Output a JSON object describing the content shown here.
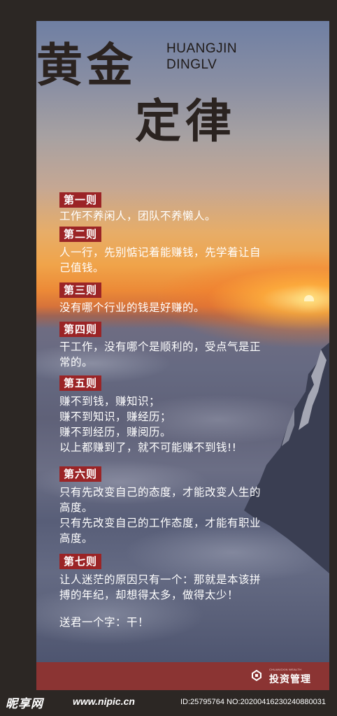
{
  "title": {
    "line1": "黄金",
    "line2": "定律",
    "english_line1": "HUANGJIN",
    "english_line2": "DINGLV"
  },
  "rules": [
    {
      "label": "第一则",
      "text": "工作不养闲人，团队不养懒人。"
    },
    {
      "label": "第二则",
      "text": "人一行，先别惦记着能赚钱，先学着让自\n己值钱。"
    },
    {
      "label": "第三则",
      "text": "没有哪个行业的钱是好赚的。"
    },
    {
      "label": "第四则",
      "text": "干工作，没有哪个是顺利的，受点气是正\n常的。"
    },
    {
      "label": "第五则",
      "text": " 赚不到钱，赚知识；\n 赚不到知识，赚经历；\n 赚不到经历，赚阅历。\n 以上都赚到了，就不可能赚不到钱!!"
    },
    {
      "label": "第六则",
      "text": "只有先改变自己的态度，才能改变人生的\n高度。\n只有先改变自己的工作态度，才能有职业\n高度。"
    },
    {
      "label": "第七则",
      "text": "让人迷茫的原因只有一个：那就是本该拼\n搏的年纪，却想得太多，做得太少！"
    }
  ],
  "closing": "送君一个字：干！",
  "footer": {
    "logo_small": "CHUANGXIN WEALTH",
    "logo_text": "投资管理"
  },
  "watermark": {
    "site_name": "昵享网",
    "url": "www.nipic.cn",
    "id_text": "ID:25795764 NO:20200416230240880031"
  },
  "colors": {
    "label_bg": "#9b2426",
    "footer_bg": "#8b3433",
    "frame": "#2c2724"
  }
}
